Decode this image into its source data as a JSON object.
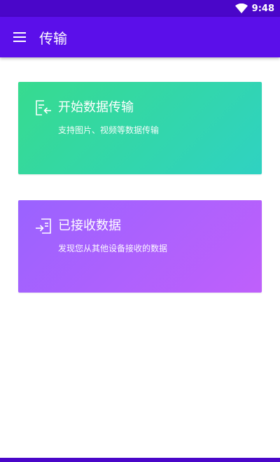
{
  "status_bar": {
    "time": "9:48",
    "icons": [
      "wifi-icon"
    ]
  },
  "app_bar": {
    "title": "传输",
    "menu_icon": "hamburger-menu-icon"
  },
  "cards": [
    {
      "title": "开始数据传输",
      "subtitle": "支持图片、视频等数据传输",
      "icon": "send-document-icon",
      "gradient": [
        "#37db8f",
        "#2fd2c2"
      ]
    },
    {
      "title": "已接收数据",
      "subtitle": "发现您从其他设备接收的数据",
      "icon": "receive-document-icon",
      "gradient": [
        "#9a62ff",
        "#bf60fb"
      ]
    }
  ],
  "colors": {
    "status_bar": "#4a06c9",
    "app_bar": "#5b0fea",
    "background": "#ffffff"
  }
}
